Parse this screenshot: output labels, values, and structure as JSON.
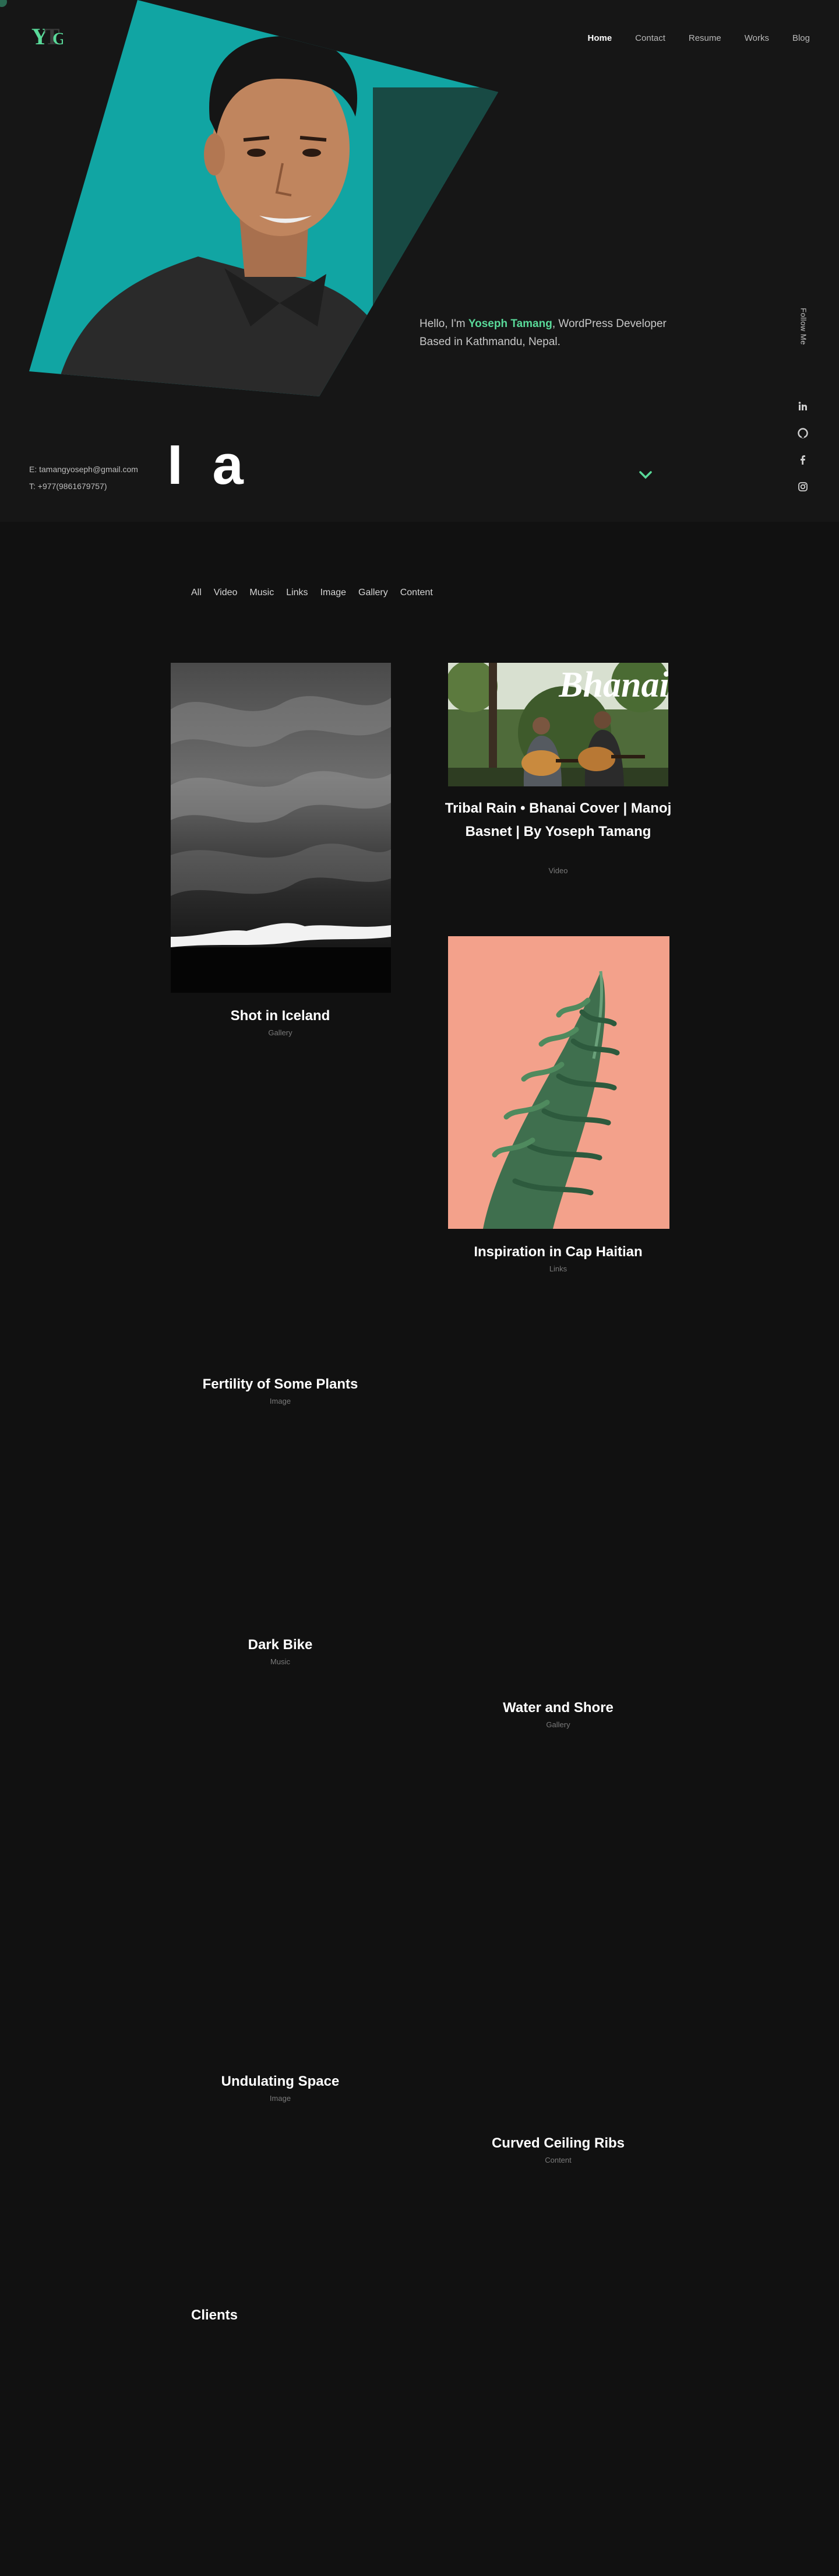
{
  "brand": {
    "logo_text": "YTG",
    "accent": "#59d999"
  },
  "nav": [
    {
      "label": "Home",
      "active": true
    },
    {
      "label": "Contact"
    },
    {
      "label": "Resume"
    },
    {
      "label": "Works"
    },
    {
      "label": "Blog"
    }
  ],
  "hero": {
    "intro_prefix": "Hello, I'm ",
    "name": "Yoseph Tamang",
    "intro_suffix": ", WordPress Developer Based in Kathmandu, Nepal.",
    "follow_label": "Follow Me",
    "social_icons": [
      "linkedin-icon",
      "github-icon",
      "facebook-icon",
      "instagram-icon"
    ],
    "email": "E: tamangyoseph@gmail.com",
    "phone": "T: +977(9861679757)",
    "big_text": "I a"
  },
  "filters": [
    "All",
    "Video",
    "Music",
    "Links",
    "Image",
    "Gallery",
    "Content"
  ],
  "works": [
    {
      "title": "Shot in Iceland",
      "category": "Gallery"
    },
    {
      "title": "Tribal Rain • Bhanai Cover | Manoj Basnet | By Yoseph Tamang",
      "category": "Video",
      "thumb_text": "Bhanai"
    },
    {
      "title": "Inspiration in Cap Haitian",
      "category": "Links"
    },
    {
      "title": "Fertility of Some Plants",
      "category": "Image"
    },
    {
      "title": "Dark Bike",
      "category": "Music"
    },
    {
      "title": "Water and Shore",
      "category": "Gallery"
    },
    {
      "title": "Undulating Space",
      "category": "Image"
    },
    {
      "title": "Curved Ceiling Ribs",
      "category": "Content"
    }
  ],
  "clients_heading": "Clients"
}
